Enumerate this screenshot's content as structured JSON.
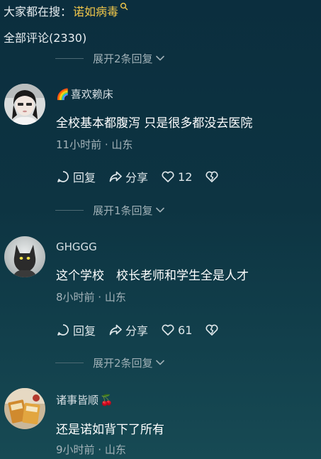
{
  "search_hint": {
    "prefix": "大家都在搜：",
    "term": "诺如病毒"
  },
  "comments_header": "全部评论(2330)",
  "expand_top": "展开2条回复",
  "comments": [
    {
      "username": "喜欢赖床",
      "username_emoji": "🌈",
      "text": "全校基本都腹泻 只是很多都没去医院",
      "meta": "11小时前 · 山东",
      "reply_label": "回复",
      "share_label": "分享",
      "likes": "12",
      "expand": "展开1条回复"
    },
    {
      "username": "GHGGG",
      "username_emoji": "",
      "text": "这个学校　校长老师和学生全是人才",
      "meta": "8小时前 · 山东",
      "reply_label": "回复",
      "share_label": "分享",
      "likes": "61",
      "expand": "展开2条回复"
    },
    {
      "username": "诸事皆顺",
      "username_emoji": "🍒",
      "text": "还是诺如背下了所有",
      "meta": "9小时前 · 山东"
    }
  ],
  "colors": {
    "accent": "#f0c64a",
    "background": "#0d3442"
  },
  "icons": [
    "search-icon",
    "chevron-down-icon",
    "reply-icon",
    "share-icon",
    "heart-icon",
    "broken-heart-icon"
  ]
}
